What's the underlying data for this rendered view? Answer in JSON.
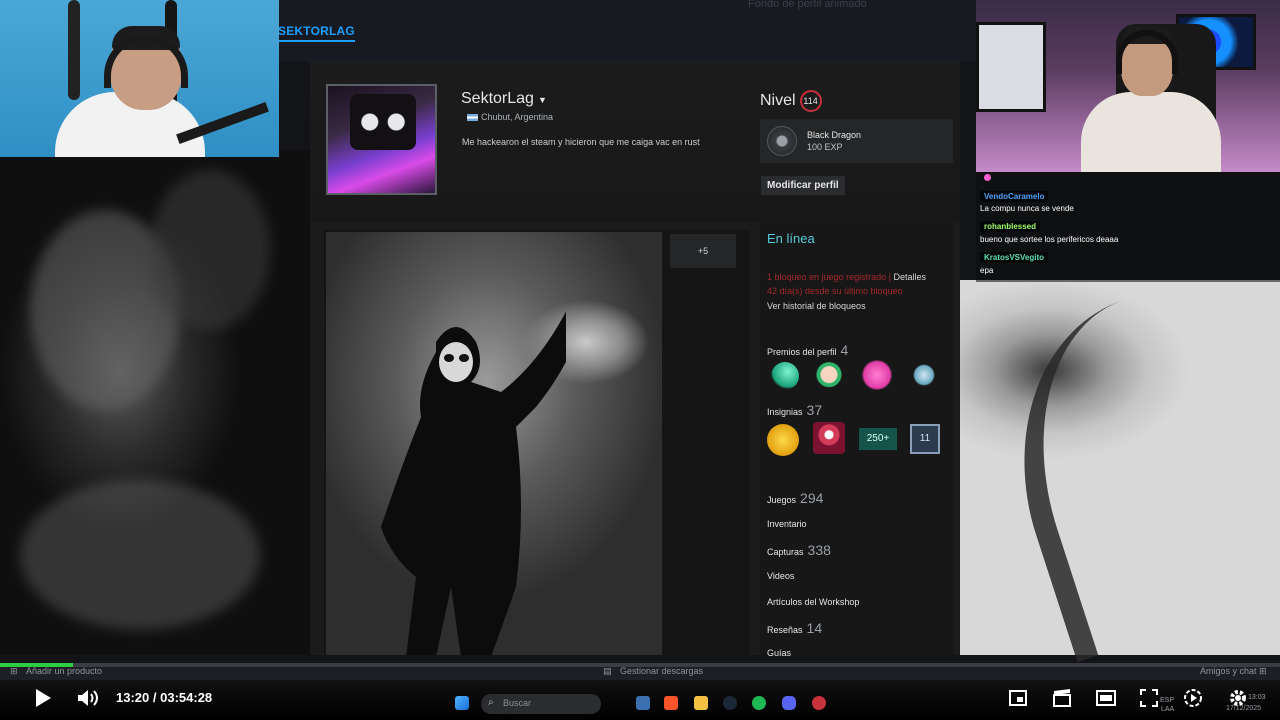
{
  "steam": {
    "nav_label": "SEKTORLAG",
    "faded_header": "Fondo de perfil animado",
    "profile": {
      "name": "SektorLag",
      "location": "Chubut, Argentina",
      "summary": "Me hackearon el steam y hicieron que me caiga vac en rust",
      "level_label": "Nivel",
      "level_value": "114",
      "badge_name": "Black Dragon",
      "badge_xp": "100 EXP",
      "edit_button": "Modificar perfil",
      "showcase_more": "+5",
      "status": "En línea",
      "ban_line": "1 bloqueo en juego registrado |",
      "ban_details": "Detalles",
      "ban_days": "42 día(s) desde su último bloqueo",
      "ban_history": "Ver historial de bloqueos",
      "awards_label": "Premios del perfil",
      "awards_count": "4",
      "badges_label": "Insignias",
      "badges_count": "37",
      "badge_250": "250+",
      "badge_11": "11",
      "games_label": "Juegos",
      "games_count": "294",
      "inventory_label": "Inventario",
      "screenshots_label": "Capturas",
      "screenshots_count": "338",
      "videos_label": "Videos",
      "workshop_label": "Artículos del Workshop",
      "reviews_label": "Reseñas",
      "reviews_count": "14",
      "guides_label": "Guías"
    }
  },
  "chat": {
    "messages": [
      {
        "user": "VendoCaramelo",
        "text": "La compu nunca se vende",
        "color": "#4da3ff"
      },
      {
        "user": "rohanblessed",
        "text": "bueno que sortee los perifericos deaaa",
        "color": "#9dff6a"
      },
      {
        "user": "KratosVSVegito",
        "text": "epa",
        "color": "#5fe0b0"
      }
    ]
  },
  "steam_bottom": {
    "add_product": "Añadir un producto",
    "manage_downloads": "Gestionar descargas",
    "friends_chat": "Amigos y chat"
  },
  "player": {
    "current_time": "13:20",
    "separator": "/",
    "duration": "03:54:28",
    "progress": 0.057,
    "search_placeholder": "Buscar",
    "lang": "ESP",
    "lang_sub": "LAA",
    "clock": "13:03",
    "date": "17/12/2025"
  }
}
